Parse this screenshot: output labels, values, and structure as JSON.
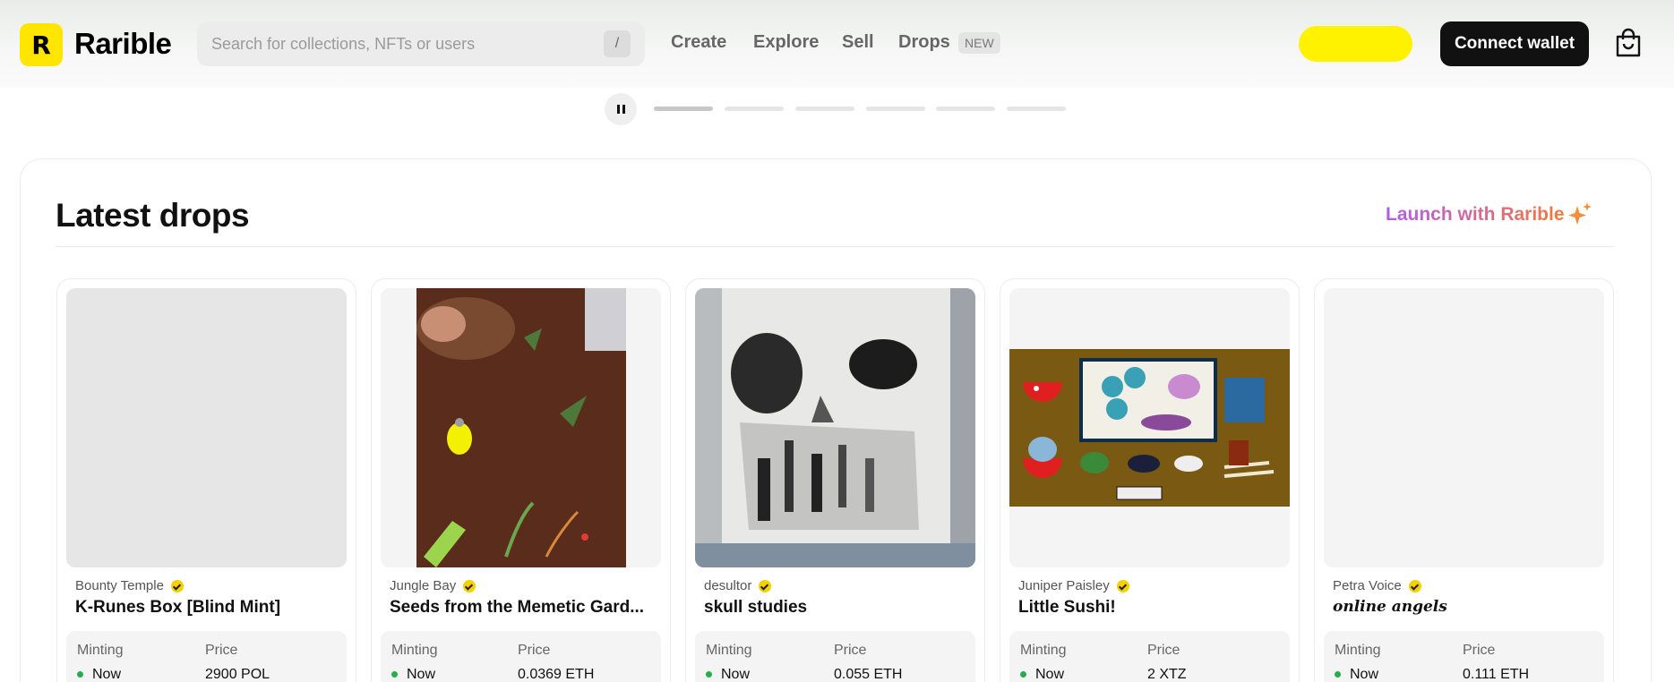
{
  "header": {
    "logo_letter": "R",
    "brand": "Rarible",
    "search_placeholder": "Search for collections, NFTs or users",
    "search_shortcut": "/",
    "nav": [
      "Create",
      "Explore",
      "Sell",
      "Drops"
    ],
    "new_badge": "NEW",
    "connect_label": "Connect wallet",
    "yellow_btn_color": "#fff200"
  },
  "carousel": {
    "slides": 6,
    "active": 0
  },
  "section": {
    "title": "Latest drops",
    "launch_label": "Launch with Rarible"
  },
  "labels": {
    "minting": "Minting",
    "price": "Price"
  },
  "cards": [
    {
      "creator": "Bounty Temple",
      "name": "K-Runes Box [Blind Mint]",
      "minting": "Now",
      "price": "2900 POL"
    },
    {
      "creator": "Jungle Bay",
      "name": "Seeds from the Memetic Gard...",
      "minting": "Now",
      "price": "0.0369 ETH"
    },
    {
      "creator": "desultor",
      "name": "skull studies",
      "minting": "Now",
      "price": "0.055 ETH"
    },
    {
      "creator": "Juniper Paisley",
      "name": "Little Sushi!",
      "minting": "Now",
      "price": "2 XTZ"
    },
    {
      "creator": "Petra Voice",
      "name": "online angels",
      "minting": "Now",
      "price": "0.111 ETH"
    }
  ],
  "colors": {
    "accent_yellow": "#ffe600",
    "status_green": "#21b04a",
    "launch_gradient_start": "#b05cf0",
    "launch_gradient_end": "#f27a3a"
  }
}
